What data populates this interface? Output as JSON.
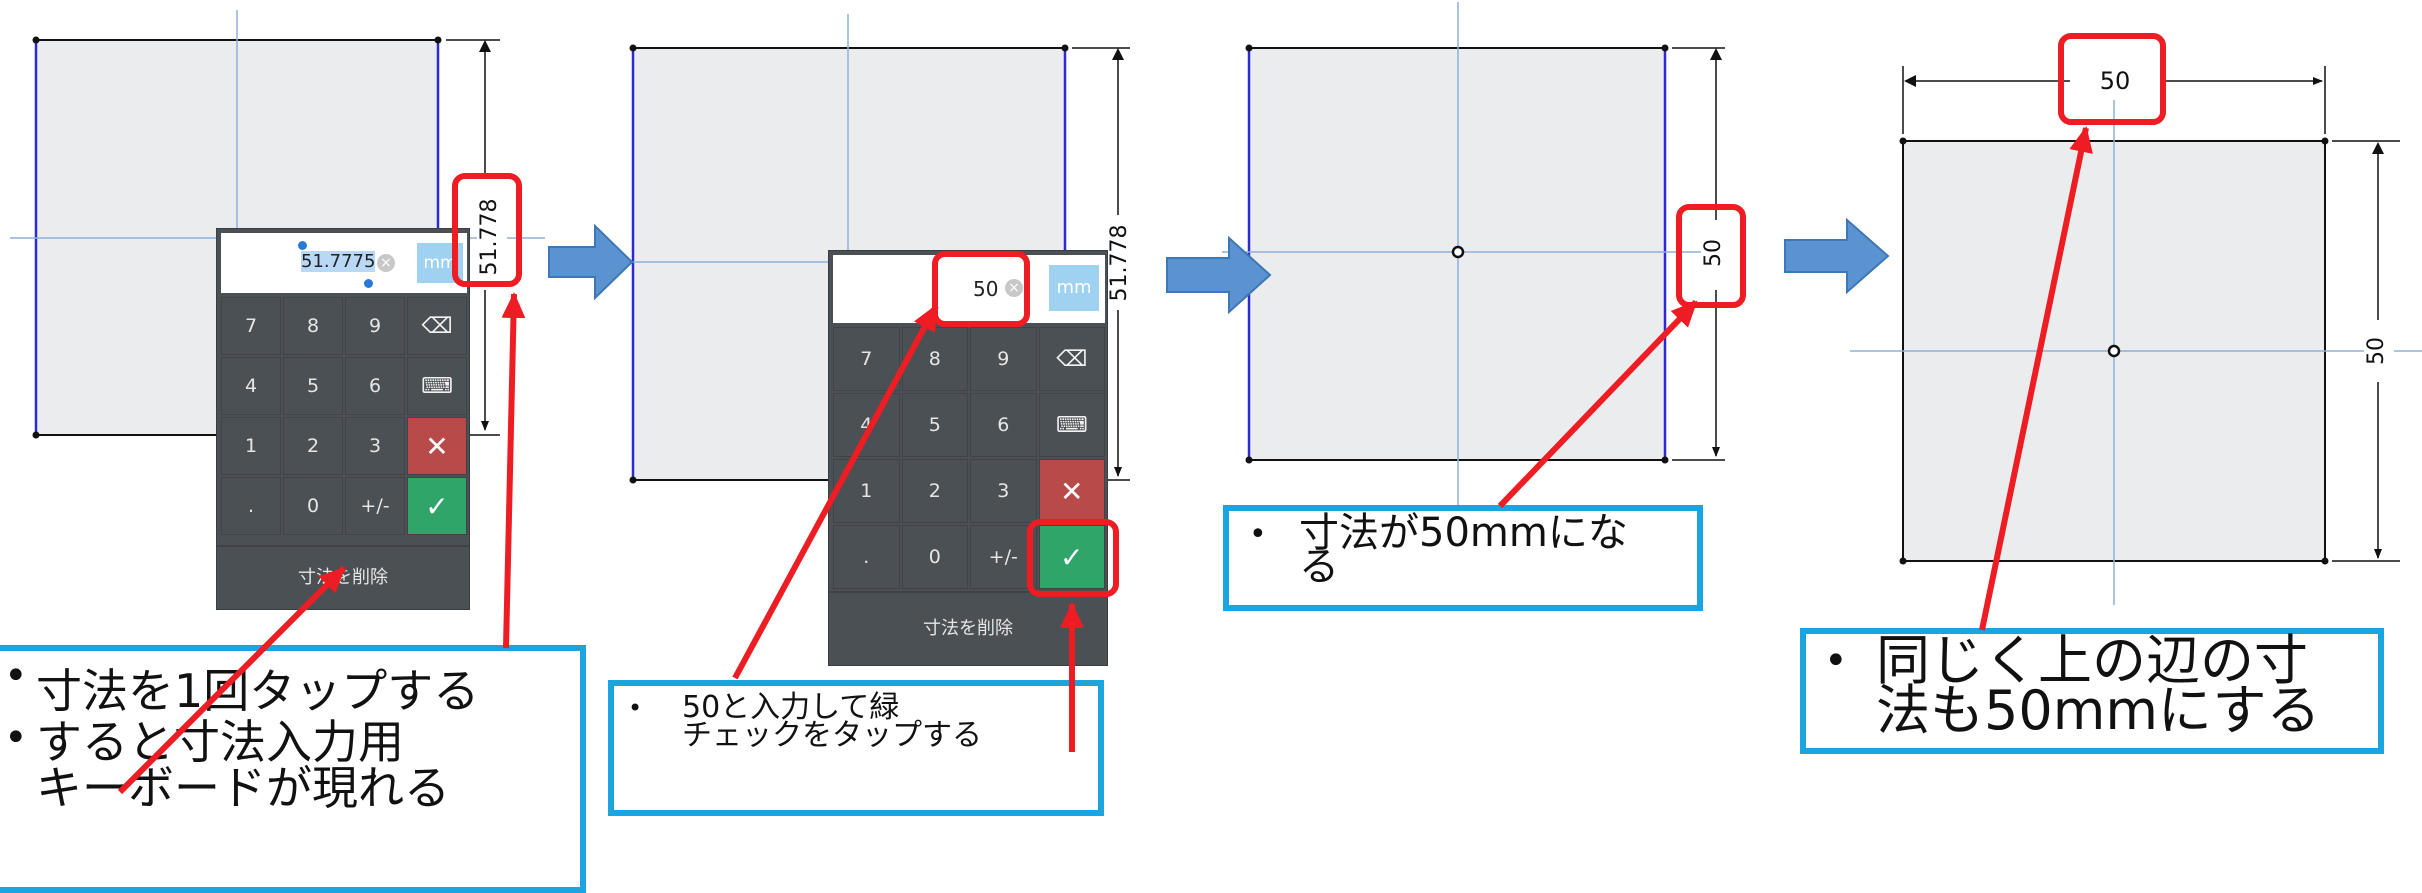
{
  "steps": [
    {
      "dimension_label": "51.778",
      "keypad": {
        "value": "51.7775",
        "unit": "mm",
        "keys": [
          "7",
          "8",
          "9",
          "⌫",
          "4",
          "5",
          "6",
          "⌨",
          "1",
          "2",
          "3",
          "✕",
          ".",
          "0",
          "+/-",
          "✓"
        ],
        "delete_label": "寸法を削除"
      },
      "note": {
        "bullets": [
          "寸法を1回タップする",
          "すると寸法入力用",
          "キーボードが現れる"
        ]
      }
    },
    {
      "dimension_label": "51.778",
      "keypad": {
        "value": "50",
        "unit": "mm",
        "keys": [
          "7",
          "8",
          "9",
          "⌫",
          "4",
          "5",
          "6",
          "⌨",
          "1",
          "2",
          "3",
          "✕",
          ".",
          "0",
          "+/-",
          "✓"
        ],
        "delete_label": "寸法を削除"
      },
      "note": {
        "bullets": [
          "50と入力して緑",
          "チェックをタップする"
        ]
      }
    },
    {
      "dimension_label": "50",
      "note": {
        "bullets": [
          "寸法が50mmにな",
          "る"
        ]
      }
    },
    {
      "dimension_top": "50",
      "dimension_right": "50",
      "note": {
        "bullets": [
          "同じく上の辺の寸",
          "法も50mmにする"
        ]
      }
    }
  ],
  "bullet_char": "•",
  "colors": {
    "highlight": "#ee1c23",
    "note_border": "#1aa5e0",
    "arrow": "#5b93d1",
    "ok_key": "#2fa56a",
    "cancel_key": "#b94a4a",
    "unit_key": "#9fd1f0"
  }
}
